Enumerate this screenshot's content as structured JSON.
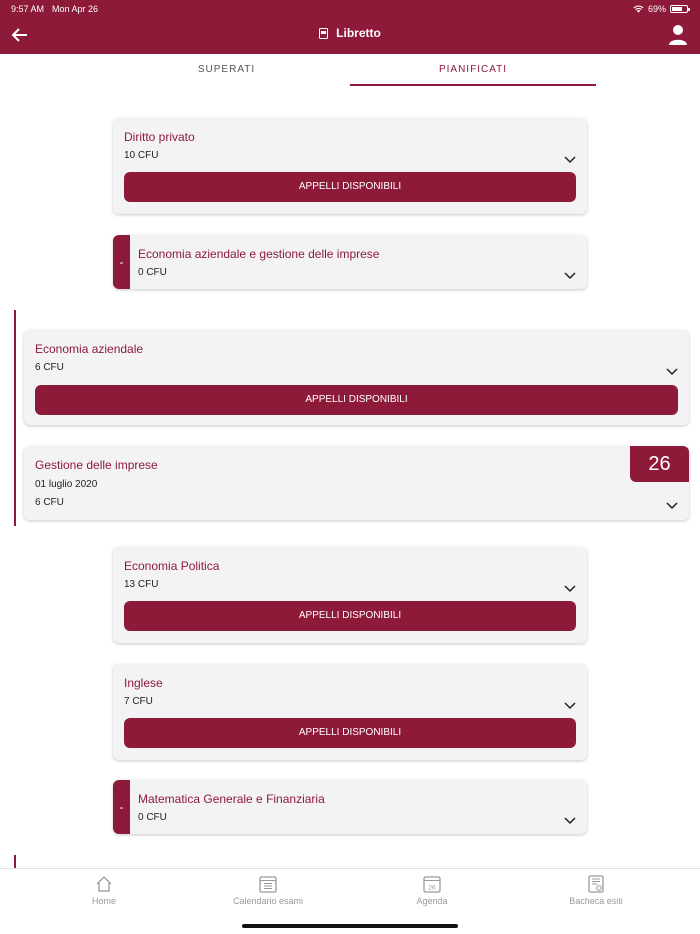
{
  "status": {
    "time": "9:57 AM",
    "date": "Mon Apr 26",
    "battery": "69%"
  },
  "header": {
    "title": "Libretto"
  },
  "tabs": [
    {
      "label": "SUPERATI",
      "active": false
    },
    {
      "label": "PIANIFICATI",
      "active": true
    }
  ],
  "cards": [
    {
      "name": "Diritto privato",
      "cfu": "10 CFU",
      "button": "APPELLI DISPONIBILI"
    },
    {
      "name": "Economia aziendale e gestione delle imprese",
      "cfu": "0 CFU",
      "marker": "-"
    },
    {
      "name": "Economia aziendale",
      "cfu": "6 CFU",
      "button": "APPELLI DISPONIBILI"
    },
    {
      "name": "Gestione delle imprese",
      "date": "01 luglio 2020",
      "cfu": "6 CFU",
      "grade": "26"
    },
    {
      "name": "Economia Politica",
      "cfu": "13 CFU",
      "button": "APPELLI DISPONIBILI"
    },
    {
      "name": "Inglese",
      "cfu": "7 CFU",
      "button": "APPELLI DISPONIBILI"
    },
    {
      "name": "Matematica Generale e Finanziaria",
      "cfu": "0 CFU",
      "marker": "-"
    }
  ],
  "bottom_nav": [
    {
      "label": "Home",
      "icon": "home-icon"
    },
    {
      "label": "Calendario esami",
      "icon": "calendar-list-icon"
    },
    {
      "label": "Agenda",
      "icon": "agenda-calendar-icon",
      "icon_text": "26"
    },
    {
      "label": "Bacheca esiti",
      "icon": "results-board-icon"
    }
  ],
  "colors": {
    "brand": "#8e1a3a",
    "card_bg": "#f3f3f6"
  }
}
